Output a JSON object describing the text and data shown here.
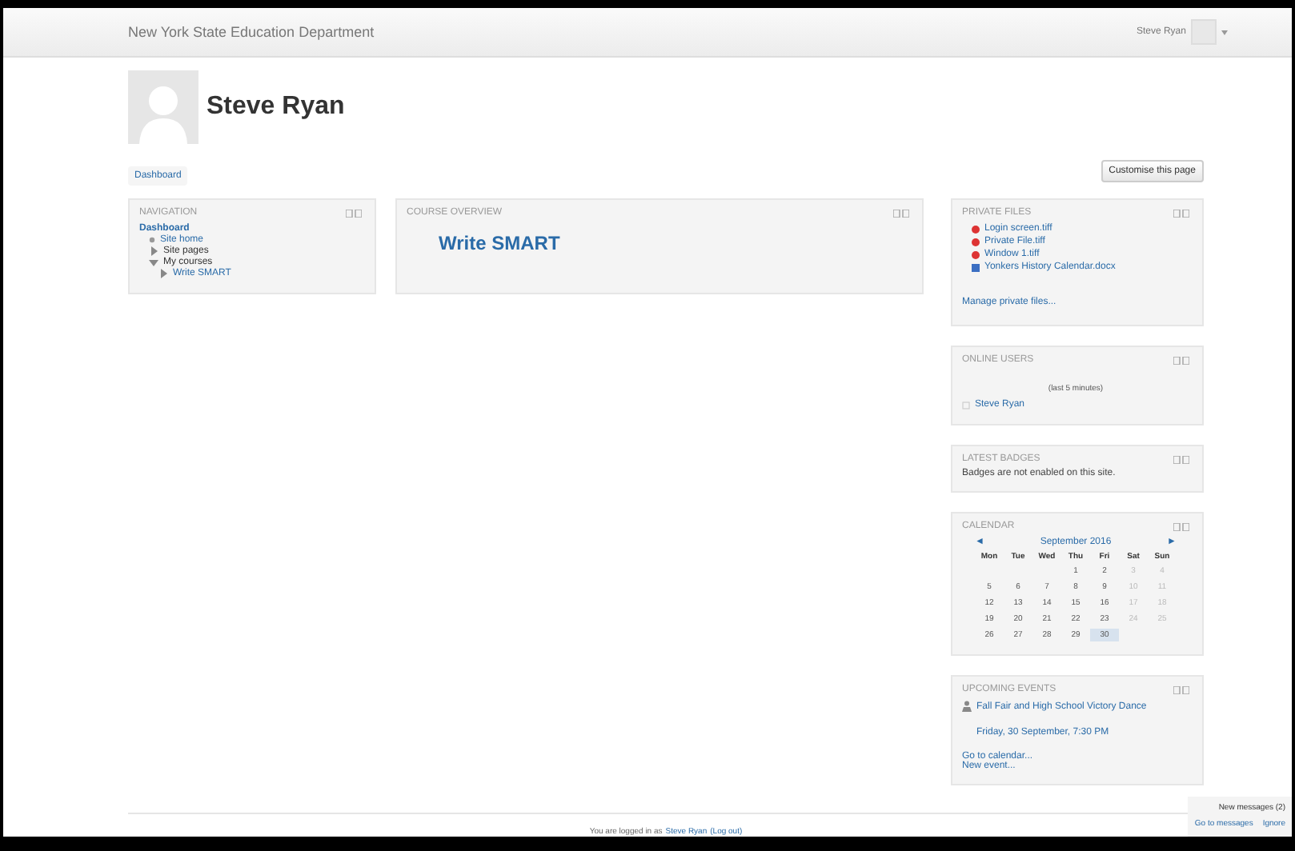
{
  "header": {
    "site_name": "New York State Education Department",
    "user_name": "Steve Ryan"
  },
  "profile": {
    "name": "Steve Ryan"
  },
  "breadcrumb": [
    "Dashboard"
  ],
  "customise_button": "Customise this page",
  "navigation": {
    "title": "NAVIGATION",
    "items": [
      {
        "label": "Dashboard",
        "kind": "root",
        "children": [
          {
            "label": "Site home",
            "kind": "leaf"
          },
          {
            "label": "Site pages",
            "kind": "branch",
            "link": false,
            "expanded": false
          },
          {
            "label": "My courses",
            "kind": "branch",
            "link": false,
            "expanded": true,
            "children": [
              {
                "label": "Write SMART",
                "kind": "branch",
                "link": true,
                "expanded": false
              }
            ]
          }
        ]
      }
    ]
  },
  "course_overview": {
    "title": "COURSE OVERVIEW",
    "courses": [
      "Write SMART"
    ]
  },
  "private_files": {
    "title": "PRIVATE FILES",
    "files": [
      {
        "name": "Login screen.tiff",
        "kind": "image"
      },
      {
        "name": "Private File.tiff",
        "kind": "image"
      },
      {
        "name": "Window 1.tiff",
        "kind": "image"
      },
      {
        "name": "Yonkers History Calendar.docx",
        "kind": "document"
      }
    ],
    "manage_link": "Manage private files..."
  },
  "online_users": {
    "title": "ONLINE USERS",
    "period": "(last 5 minutes)",
    "users": [
      "Steve Ryan"
    ]
  },
  "latest_badges": {
    "title": "LATEST BADGES",
    "message": "Badges are not enabled on this site."
  },
  "calendar": {
    "title": "CALENDAR",
    "prev": "◄",
    "next": "►",
    "month": "September 2016",
    "weekdays": [
      "Mon",
      "Tue",
      "Wed",
      "Thu",
      "Fri",
      "Sat",
      "Sun"
    ],
    "weeks": [
      [
        {
          "kind": "blank"
        },
        {
          "kind": "blank"
        },
        {
          "kind": "blank"
        },
        {
          "kind": "day",
          "day": "1",
          "today": false
        },
        {
          "kind": "day",
          "day": "2",
          "today": false
        },
        {
          "kind": "day",
          "day": "3",
          "today": false
        },
        {
          "kind": "day",
          "day": "4",
          "today": false
        }
      ],
      [
        {
          "kind": "day",
          "day": "5",
          "today": false
        },
        {
          "kind": "day",
          "day": "6",
          "today": false
        },
        {
          "kind": "day",
          "day": "7",
          "today": false
        },
        {
          "kind": "day",
          "day": "8",
          "today": false
        },
        {
          "kind": "day",
          "day": "9",
          "today": false
        },
        {
          "kind": "day",
          "day": "10",
          "today": false
        },
        {
          "kind": "day",
          "day": "11",
          "today": false
        }
      ],
      [
        {
          "kind": "day",
          "day": "12",
          "today": false
        },
        {
          "kind": "day",
          "day": "13",
          "today": false
        },
        {
          "kind": "day",
          "day": "14",
          "today": false
        },
        {
          "kind": "day",
          "day": "15",
          "today": false
        },
        {
          "kind": "day",
          "day": "16",
          "today": false
        },
        {
          "kind": "day",
          "day": "17",
          "today": false
        },
        {
          "kind": "day",
          "day": "18",
          "today": false
        }
      ],
      [
        {
          "kind": "day",
          "day": "19",
          "today": false
        },
        {
          "kind": "day",
          "day": "20",
          "today": false
        },
        {
          "kind": "day",
          "day": "21",
          "today": false
        },
        {
          "kind": "day",
          "day": "22",
          "today": false
        },
        {
          "kind": "day",
          "day": "23",
          "today": false
        },
        {
          "kind": "day",
          "day": "24",
          "today": false
        },
        {
          "kind": "day",
          "day": "25",
          "today": false
        }
      ],
      [
        {
          "kind": "day",
          "day": "26",
          "today": false
        },
        {
          "kind": "day",
          "day": "27",
          "today": false
        },
        {
          "kind": "day",
          "day": "28",
          "today": false
        },
        {
          "kind": "day",
          "day": "29",
          "today": false
        },
        {
          "kind": "day",
          "day": "30",
          "today": true
        },
        {
          "kind": "blank"
        },
        {
          "kind": "blank"
        }
      ]
    ]
  },
  "upcoming_events": {
    "title": "UPCOMING EVENTS",
    "events": [
      {
        "name": "Fall Fair and High School Victory Dance",
        "date": "Friday, 30 September, 7:30 PM"
      }
    ],
    "links": [
      "Go to calendar...",
      "New event..."
    ]
  },
  "messages_popup": {
    "title": "New messages (2)",
    "go_link": "Go to messages",
    "ignore_link": "Ignore"
  },
  "footer": {
    "text": "You are logged in as",
    "user_link": "Steve Ryan",
    "logout_link": "(Log out)"
  }
}
